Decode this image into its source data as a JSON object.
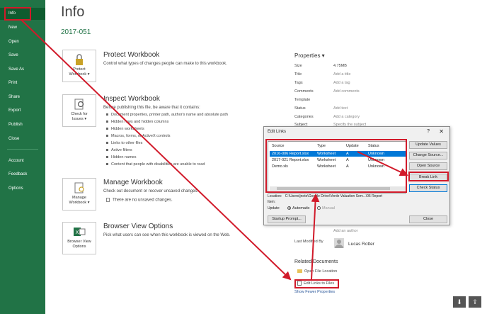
{
  "sidebar": {
    "items": [
      {
        "label": "Info",
        "active": true
      },
      {
        "label": "New"
      },
      {
        "label": "Open"
      },
      {
        "label": "Save"
      },
      {
        "label": "Save As"
      },
      {
        "label": "Print"
      },
      {
        "label": "Share"
      },
      {
        "label": "Export"
      },
      {
        "label": "Publish"
      },
      {
        "label": "Close"
      },
      {
        "label": "Account"
      },
      {
        "label": "Feedback"
      },
      {
        "label": "Options"
      }
    ]
  },
  "main": {
    "title": "Info",
    "file_name": "2017-051",
    "sections": [
      {
        "button_label_1": "Protect",
        "button_label_2": "Workbook ▾",
        "title": "Protect Workbook",
        "description": "Control what types of changes people can make to this workbook."
      },
      {
        "button_label_1": "Check for",
        "button_label_2": "Issues ▾",
        "title": "Inspect Workbook",
        "description": "Before publishing this file, be aware that it contains:",
        "bullets": [
          "Document properties, printer path, author's name and absolute path",
          "Hidden rows and hidden columns",
          "Hidden worksheets",
          "Macros, forms, or ActiveX controls",
          "Links to other files",
          "Active filters",
          "Hidden names",
          "Content that people with disabilities are unable to read"
        ]
      },
      {
        "button_label_1": "Manage",
        "button_label_2": "Workbook ▾",
        "title": "Manage Workbook",
        "description": "Check out document or recover unsaved changes.",
        "note": "There are no unsaved changes."
      },
      {
        "button_label_1": "Browser View",
        "button_label_2": "Options",
        "title": "Browser View Options",
        "description": "Pick what users can see when this workbook is viewed on the Web."
      }
    ]
  },
  "properties": {
    "heading": "Properties ▾",
    "rows": [
      {
        "label": "Size",
        "value": "4.75MB",
        "placeholder": false
      },
      {
        "label": "Title",
        "value": "Add a title",
        "placeholder": true
      },
      {
        "label": "Tags",
        "value": "Add a tag",
        "placeholder": true
      },
      {
        "label": "Comments",
        "value": "Add comments",
        "placeholder": true
      },
      {
        "label": "Template",
        "value": "",
        "placeholder": false
      },
      {
        "label": "Status",
        "value": "Add text",
        "placeholder": true
      },
      {
        "label": "Categories",
        "value": "Add a category",
        "placeholder": true
      },
      {
        "label": "Subject",
        "value": "Specify the subject",
        "placeholder": true
      }
    ],
    "add_author": "Add an author",
    "last_modified_label": "Last Modified By",
    "last_modified_by": "Lucas Rotter"
  },
  "related": {
    "heading": "Related Documents",
    "open_location": "Open File Location",
    "edit_links": "Edit Links to Files",
    "show_fewer": "Show Fewer Properties"
  },
  "dialog": {
    "title": "Edit Links",
    "help": "?",
    "close": "✕",
    "columns": [
      "Source",
      "Type",
      "Update",
      "Status"
    ],
    "rows": [
      {
        "source": "2016-006 Report.xlsx",
        "type": "Worksheet",
        "update": "A",
        "status": "Unknown"
      },
      {
        "source": "2017-021 Report.xlsx",
        "type": "Worksheet",
        "update": "A",
        "status": "Unknown"
      },
      {
        "source": "Demo.xls",
        "type": "Worksheet",
        "update": "A",
        "status": "Unknown"
      }
    ],
    "buttons": {
      "update_values": "Update Values",
      "change_source": "Change Source...",
      "open_source": "Open Source",
      "break_link": "Break Link",
      "check_status": "Check Status",
      "startup_prompt": "Startup Prompt...",
      "close": "Close"
    },
    "location_label": "Location:",
    "location_value": "C:\\Users\\jnoto\\Google Drive\\Verde Valuation Serv...\\06 Report",
    "item_label": "Item:",
    "update_label": "Update:",
    "automatic": "Automatic",
    "manual": "Manual"
  },
  "colors": {
    "accent": "#217346",
    "highlight": "#d11a2a",
    "selection": "#0078d7"
  }
}
